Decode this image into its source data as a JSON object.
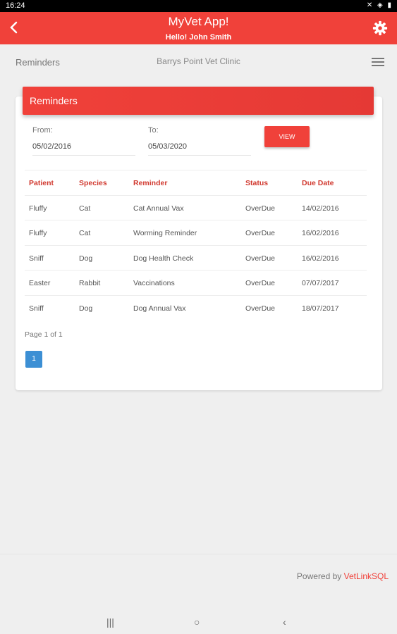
{
  "status": {
    "time": "16:24",
    "icons": "✕ ◈ ▮"
  },
  "appbar": {
    "title": "MyVet App!",
    "subtitle": "Hello! John Smith"
  },
  "subheader": {
    "left": "Reminders",
    "clinic": "Barrys Point Vet Clinic"
  },
  "card": {
    "title": "Reminders",
    "from_label": "From:",
    "from_value": "05/02/2016",
    "to_label": "To:",
    "to_value": "05/03/2020",
    "view_label": "VIEW"
  },
  "table": {
    "headers": [
      "Patient",
      "Species",
      "Reminder",
      "Status",
      "Due Date"
    ],
    "rows": [
      [
        "Fluffy",
        "Cat",
        "Cat Annual Vax",
        "OverDue",
        "14/02/2016"
      ],
      [
        "Fluffy",
        "Cat",
        "Worming Reminder",
        "OverDue",
        "16/02/2016"
      ],
      [
        "Sniff",
        "Dog",
        "Dog Health Check",
        "OverDue",
        "16/02/2016"
      ],
      [
        "Easter",
        "Rabbit",
        "Vaccinations",
        "OverDue",
        "07/07/2017"
      ],
      [
        "Sniff",
        "Dog",
        "Dog Annual Vax",
        "OverDue",
        "18/07/2017"
      ]
    ]
  },
  "pagination": {
    "info": "Page 1 of 1",
    "current": "1"
  },
  "footer": {
    "powered_by": "Powered by ",
    "brand": "VetLinkSQL"
  },
  "navbar": {
    "recents": "|||",
    "home": "○",
    "back": "‹"
  },
  "colors": {
    "accent": "#f0413a",
    "page_button": "#3c8fd4"
  }
}
